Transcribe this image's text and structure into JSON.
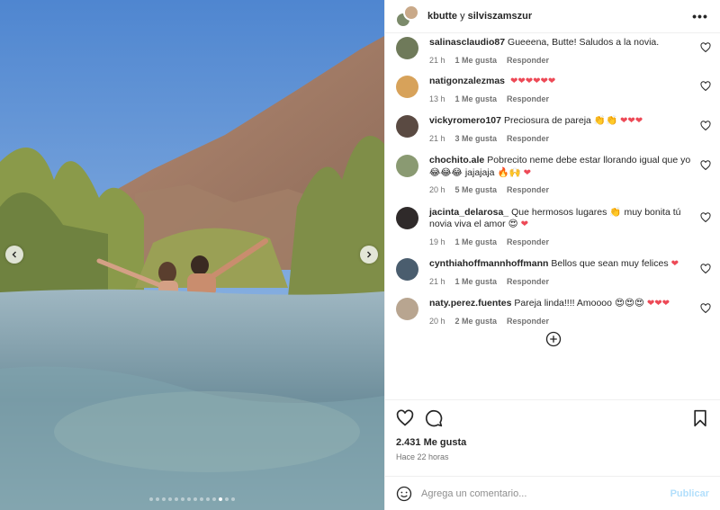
{
  "header": {
    "user1": "kbutte",
    "joiner": "y",
    "user2": "silviszamszur",
    "more_icon": "more-horizontal-icon"
  },
  "media": {
    "prev_icon": "chevron-left-icon",
    "next_icon": "chevron-right-icon",
    "dots_total": 14,
    "dot_active_index": 11
  },
  "comments": [
    {
      "user": "salinasclaudio87",
      "text": "Gueeena, Butte! Saludos a la novia.",
      "hearts": 0,
      "emojis": "",
      "time": "21 h",
      "likes": "1 Me gusta",
      "reply": "Responder",
      "avatar_color": "#6f7a5a"
    },
    {
      "user": "natigonzalezmas",
      "text": "",
      "hearts": 6,
      "emojis": "",
      "time": "13 h",
      "likes": "1 Me gusta",
      "reply": "Responder",
      "avatar_color": "#d7a25a"
    },
    {
      "user": "vickyromero107",
      "text": "Preciosura de pareja",
      "hearts": 3,
      "emojis": "👏👏",
      "time": "21 h",
      "likes": "3 Me gusta",
      "reply": "Responder",
      "avatar_color": "#5a4a42"
    },
    {
      "user": "chochito.ale",
      "text": "Pobrecito neme debe estar llorando igual que yo",
      "line2": "jajajaja",
      "hearts": 1,
      "emojis": "😂😂😂",
      "emojis2": "🔥🙌",
      "time": "20 h",
      "likes": "5 Me gusta",
      "reply": "Responder",
      "avatar_color": "#8a9a72"
    },
    {
      "user": "jacinta_delarosa_",
      "text": "Que hermosos lugares",
      "line2": "novia viva el amor",
      "mid": "muy bonita tú",
      "hearts": 1,
      "emojis": "👏",
      "emojis2": "😍",
      "time": "19 h",
      "likes": "1 Me gusta",
      "reply": "Responder",
      "avatar_color": "#2f2a2a"
    },
    {
      "user": "cynthiahoffmannhoffmann",
      "text": "Bellos que sean muy felices",
      "hearts": 1,
      "emojis": "",
      "time": "21 h",
      "likes": "1 Me gusta",
      "reply": "Responder",
      "avatar_color": "#4a5d6e"
    },
    {
      "user": "naty.perez.fuentes",
      "text": "Pareja linda!!!! Amoooo",
      "hearts": 3,
      "emojis": "😍😍😍",
      "time": "20 h",
      "likes": "2 Me gusta",
      "reply": "Responder",
      "avatar_color": "#b8a590"
    }
  ],
  "load_more_icon": "plus-circle-icon",
  "actions": {
    "like_icon": "heart-icon",
    "comment_icon": "comment-icon",
    "save_icon": "bookmark-icon"
  },
  "likes_count": "2.431 Me gusta",
  "posted_ago": "Hace 22 horas",
  "composer": {
    "emoji_icon": "smiley-icon",
    "placeholder": "Agrega un comentario...",
    "publish_label": "Publicar"
  },
  "colors": {
    "heart": "#ed4956",
    "publish_disabled": "#b2dffc",
    "meta_text": "#737373"
  }
}
